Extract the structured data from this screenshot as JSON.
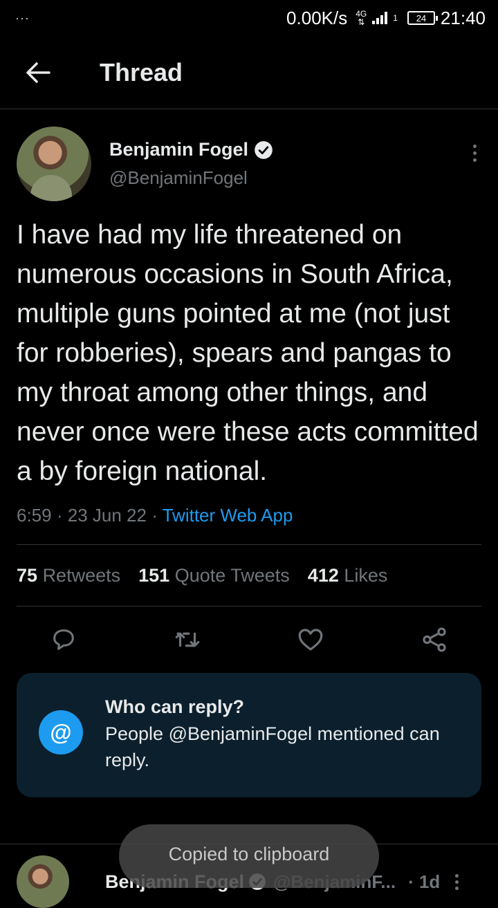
{
  "status_bar": {
    "dots": "···",
    "net_speed": "0.00K/s",
    "network": "4G",
    "sim": "1",
    "battery": "24",
    "time": "21:40"
  },
  "header": {
    "title": "Thread"
  },
  "tweet": {
    "author_name": "Benjamin Fogel",
    "author_handle": "@BenjaminFogel",
    "text": "I have had my life threatened on numerous occasions in South Africa, multiple guns pointed at me (not just for robberies), spears and pangas to my throat among other things, and never once were these acts committed a by foreign national.",
    "time": "6:59",
    "date": "23 Jun 22",
    "source": "Twitter Web App",
    "stats": {
      "retweets_count": "75",
      "retweets_label": "Retweets",
      "quotes_count": "151",
      "quotes_label": "Quote Tweets",
      "likes_count": "412",
      "likes_label": "Likes"
    }
  },
  "reply_restriction": {
    "icon": "@",
    "title": "Who can reply?",
    "description": "People @BenjaminFogel mentioned can reply."
  },
  "next_tweet": {
    "author_name": "Benjamin Fogel",
    "author_handle": "@BenjaminF...",
    "time": "· 1d"
  },
  "toast": {
    "message": "Copied to clipboard"
  },
  "colors": {
    "background": "#000000",
    "accent": "#1d9bf0",
    "secondary_text": "#71767b",
    "card_bg": "#0c1f2c"
  }
}
